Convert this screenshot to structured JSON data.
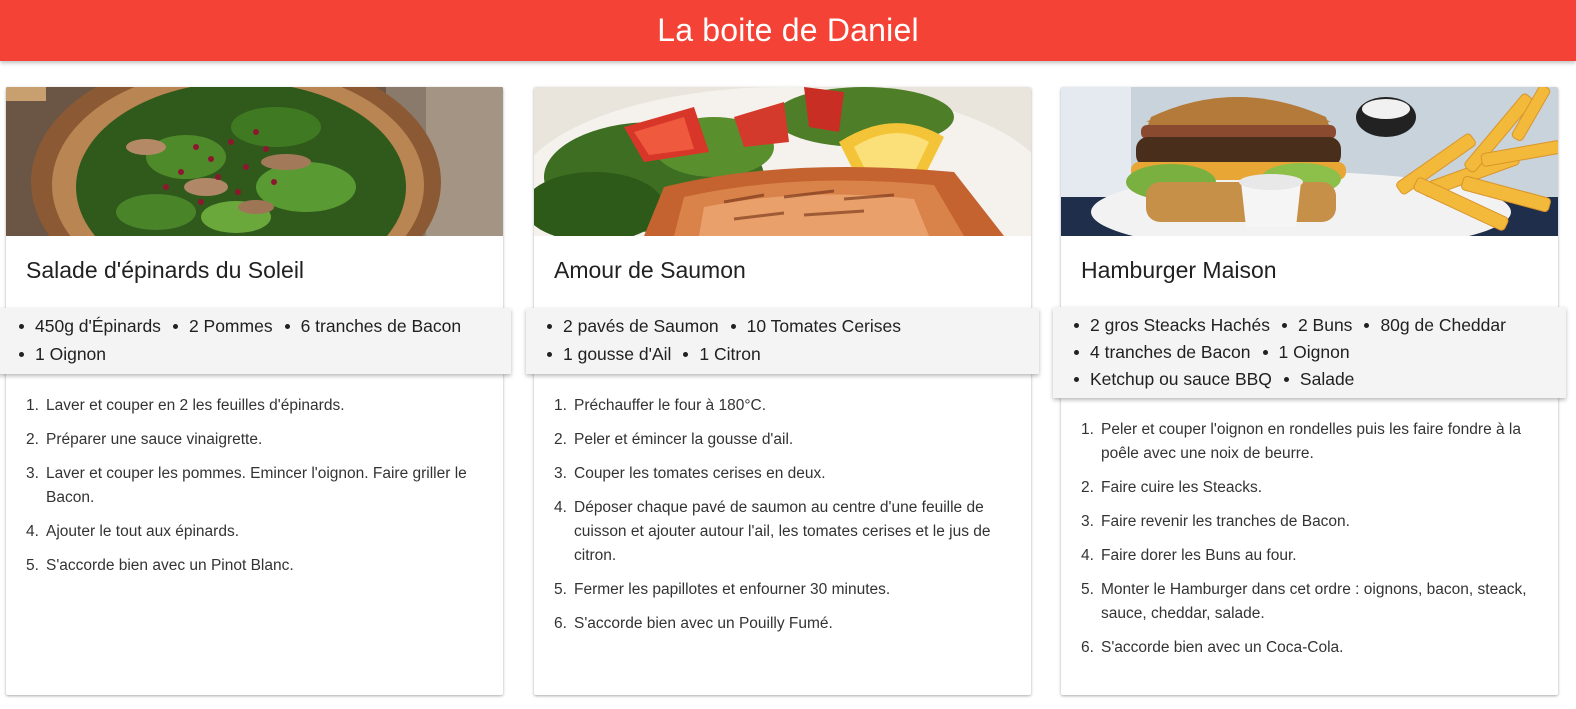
{
  "app": {
    "title": "La boite de Daniel",
    "accent_color": "#f44336"
  },
  "cards": [
    {
      "title": "Salade d'épinards du Soleil",
      "image": "spinach-salad-photo",
      "ingredients": [
        "450g d'Épinards",
        "2 Pommes",
        "6 tranches de Bacon",
        "1 Oignon"
      ],
      "steps": [
        "Laver et couper en 2 les feuilles d'épinards.",
        "Préparer une sauce vinaigrette.",
        "Laver et couper les pommes. Emincer l'oignon. Faire griller le Bacon.",
        "Ajouter le tout aux épinards.",
        "S'accorde bien avec un Pinot Blanc."
      ]
    },
    {
      "title": "Amour de Saumon",
      "image": "salmon-plate-photo",
      "ingredients": [
        "2 pavés de Saumon",
        "10 Tomates Cerises",
        "1 gousse d'Ail",
        "1 Citron"
      ],
      "steps": [
        "Préchauffer le four à 180°C.",
        "Peler et émincer la gousse d'ail.",
        "Couper les tomates cerises en deux.",
        "Déposer chaque pavé de saumon au centre d'une feuille de cuisson et ajouter autour l'ail, les tomates cerises et le jus de citron.",
        "Fermer les papillotes et enfourner 30 minutes.",
        "S'accorde bien avec un Pouilly Fumé."
      ]
    },
    {
      "title": "Hamburger Maison",
      "image": "burger-fries-photo",
      "ingredients": [
        "2 gros Steacks Hachés",
        "2 Buns",
        "80g de Cheddar",
        "4 tranches de Bacon",
        "1 Oignon",
        "Ketchup ou sauce BBQ",
        "Salade"
      ],
      "steps": [
        "Peler et couper l'oignon en rondelles puis les faire fondre à la poêle avec une noix de beurre.",
        "Faire cuire les Steacks.",
        "Faire revenir les tranches de Bacon.",
        "Faire dorer les Buns au four.",
        "Monter le Hamburger dans cet ordre : oignons, bacon, steack, sauce, cheddar, salade.",
        "S'accorde bien avec un Coca-Cola."
      ]
    }
  ]
}
